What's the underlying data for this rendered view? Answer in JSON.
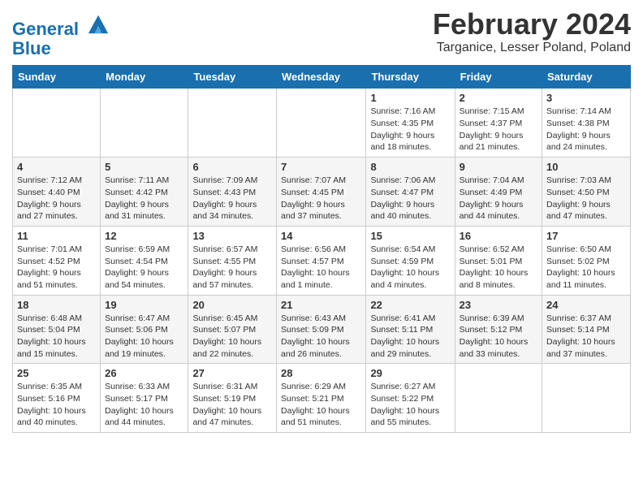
{
  "header": {
    "logo_line1": "General",
    "logo_line2": "Blue",
    "title": "February 2024",
    "subtitle": "Targanice, Lesser Poland, Poland"
  },
  "calendar": {
    "days_of_week": [
      "Sunday",
      "Monday",
      "Tuesday",
      "Wednesday",
      "Thursday",
      "Friday",
      "Saturday"
    ],
    "weeks": [
      [
        {
          "day": "",
          "info": ""
        },
        {
          "day": "",
          "info": ""
        },
        {
          "day": "",
          "info": ""
        },
        {
          "day": "",
          "info": ""
        },
        {
          "day": "1",
          "info": "Sunrise: 7:16 AM\nSunset: 4:35 PM\nDaylight: 9 hours\nand 18 minutes."
        },
        {
          "day": "2",
          "info": "Sunrise: 7:15 AM\nSunset: 4:37 PM\nDaylight: 9 hours\nand 21 minutes."
        },
        {
          "day": "3",
          "info": "Sunrise: 7:14 AM\nSunset: 4:38 PM\nDaylight: 9 hours\nand 24 minutes."
        }
      ],
      [
        {
          "day": "4",
          "info": "Sunrise: 7:12 AM\nSunset: 4:40 PM\nDaylight: 9 hours\nand 27 minutes."
        },
        {
          "day": "5",
          "info": "Sunrise: 7:11 AM\nSunset: 4:42 PM\nDaylight: 9 hours\nand 31 minutes."
        },
        {
          "day": "6",
          "info": "Sunrise: 7:09 AM\nSunset: 4:43 PM\nDaylight: 9 hours\nand 34 minutes."
        },
        {
          "day": "7",
          "info": "Sunrise: 7:07 AM\nSunset: 4:45 PM\nDaylight: 9 hours\nand 37 minutes."
        },
        {
          "day": "8",
          "info": "Sunrise: 7:06 AM\nSunset: 4:47 PM\nDaylight: 9 hours\nand 40 minutes."
        },
        {
          "day": "9",
          "info": "Sunrise: 7:04 AM\nSunset: 4:49 PM\nDaylight: 9 hours\nand 44 minutes."
        },
        {
          "day": "10",
          "info": "Sunrise: 7:03 AM\nSunset: 4:50 PM\nDaylight: 9 hours\nand 47 minutes."
        }
      ],
      [
        {
          "day": "11",
          "info": "Sunrise: 7:01 AM\nSunset: 4:52 PM\nDaylight: 9 hours\nand 51 minutes."
        },
        {
          "day": "12",
          "info": "Sunrise: 6:59 AM\nSunset: 4:54 PM\nDaylight: 9 hours\nand 54 minutes."
        },
        {
          "day": "13",
          "info": "Sunrise: 6:57 AM\nSunset: 4:55 PM\nDaylight: 9 hours\nand 57 minutes."
        },
        {
          "day": "14",
          "info": "Sunrise: 6:56 AM\nSunset: 4:57 PM\nDaylight: 10 hours\nand 1 minute."
        },
        {
          "day": "15",
          "info": "Sunrise: 6:54 AM\nSunset: 4:59 PM\nDaylight: 10 hours\nand 4 minutes."
        },
        {
          "day": "16",
          "info": "Sunrise: 6:52 AM\nSunset: 5:01 PM\nDaylight: 10 hours\nand 8 minutes."
        },
        {
          "day": "17",
          "info": "Sunrise: 6:50 AM\nSunset: 5:02 PM\nDaylight: 10 hours\nand 11 minutes."
        }
      ],
      [
        {
          "day": "18",
          "info": "Sunrise: 6:48 AM\nSunset: 5:04 PM\nDaylight: 10 hours\nand 15 minutes."
        },
        {
          "day": "19",
          "info": "Sunrise: 6:47 AM\nSunset: 5:06 PM\nDaylight: 10 hours\nand 19 minutes."
        },
        {
          "day": "20",
          "info": "Sunrise: 6:45 AM\nSunset: 5:07 PM\nDaylight: 10 hours\nand 22 minutes."
        },
        {
          "day": "21",
          "info": "Sunrise: 6:43 AM\nSunset: 5:09 PM\nDaylight: 10 hours\nand 26 minutes."
        },
        {
          "day": "22",
          "info": "Sunrise: 6:41 AM\nSunset: 5:11 PM\nDaylight: 10 hours\nand 29 minutes."
        },
        {
          "day": "23",
          "info": "Sunrise: 6:39 AM\nSunset: 5:12 PM\nDaylight: 10 hours\nand 33 minutes."
        },
        {
          "day": "24",
          "info": "Sunrise: 6:37 AM\nSunset: 5:14 PM\nDaylight: 10 hours\nand 37 minutes."
        }
      ],
      [
        {
          "day": "25",
          "info": "Sunrise: 6:35 AM\nSunset: 5:16 PM\nDaylight: 10 hours\nand 40 minutes."
        },
        {
          "day": "26",
          "info": "Sunrise: 6:33 AM\nSunset: 5:17 PM\nDaylight: 10 hours\nand 44 minutes."
        },
        {
          "day": "27",
          "info": "Sunrise: 6:31 AM\nSunset: 5:19 PM\nDaylight: 10 hours\nand 47 minutes."
        },
        {
          "day": "28",
          "info": "Sunrise: 6:29 AM\nSunset: 5:21 PM\nDaylight: 10 hours\nand 51 minutes."
        },
        {
          "day": "29",
          "info": "Sunrise: 6:27 AM\nSunset: 5:22 PM\nDaylight: 10 hours\nand 55 minutes."
        },
        {
          "day": "",
          "info": ""
        },
        {
          "day": "",
          "info": ""
        }
      ]
    ]
  }
}
